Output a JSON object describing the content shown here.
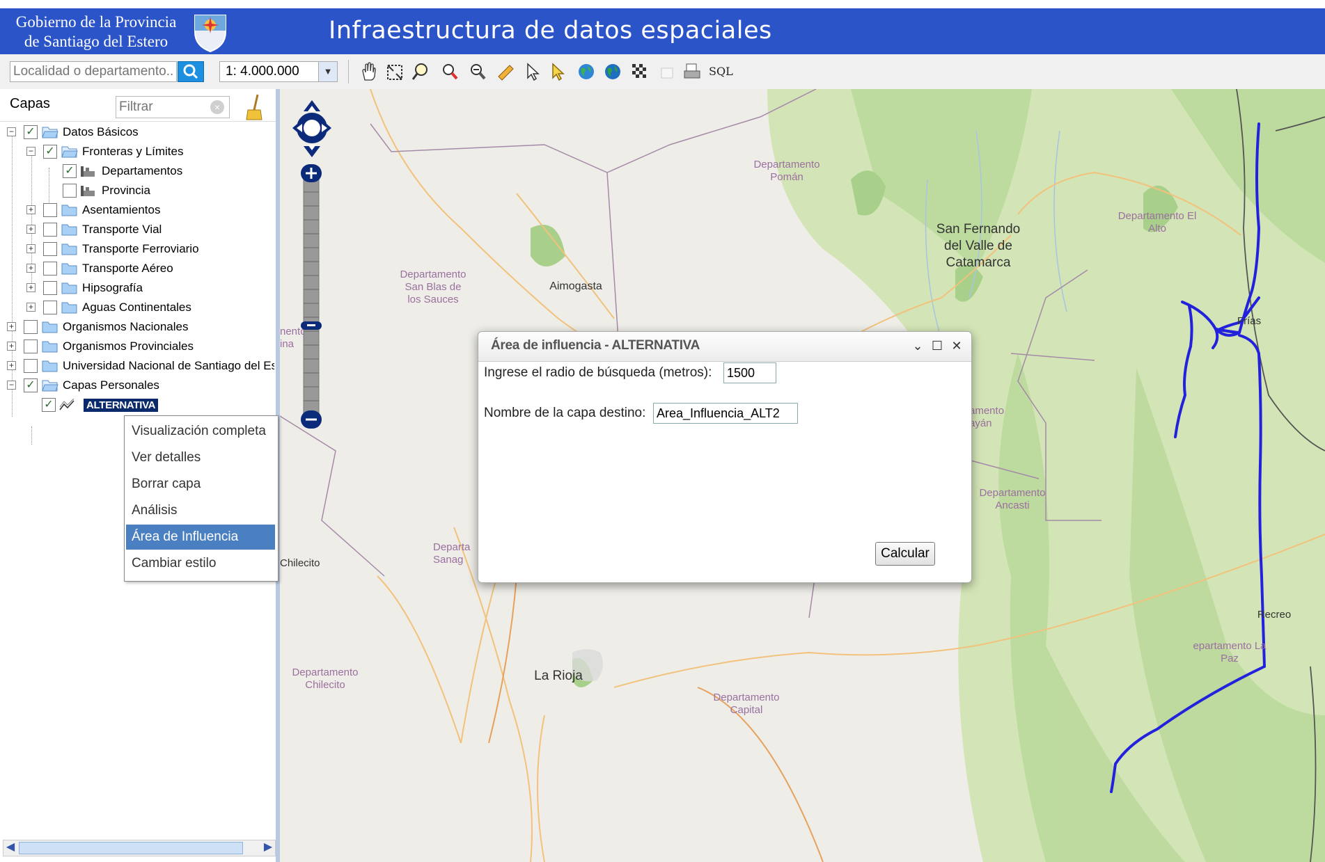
{
  "header": {
    "gov_line1": "Gobierno de la Provincia",
    "gov_line2": "de Santiago del Estero",
    "app_title": "Infraestructura de datos espaciales",
    "bg_color": "#2b54c9"
  },
  "toolbar": {
    "search_placeholder": "Localidad o departamento...",
    "scale_value": "1: 4.000.000",
    "sql_label": "SQL",
    "tools": [
      "pan-hand-icon",
      "zoom-extent-icon",
      "zoom-box-icon",
      "zoom-in-icon",
      "zoom-out-icon",
      "measure-icon",
      "info-icon",
      "select-icon",
      "globe-icon",
      "globe-2-icon",
      "grid-icon",
      "blank-icon",
      "print-icon"
    ]
  },
  "panel": {
    "title": "Capas",
    "filter_placeholder": "Filtrar",
    "tree": [
      {
        "label": "Datos Básicos",
        "checked": true
      },
      {
        "label": "Fronteras y Límites",
        "checked": true
      },
      {
        "label": "Departamentos",
        "checked": true
      },
      {
        "label": "Provincia",
        "checked": false
      },
      {
        "label": "Asentamientos",
        "checked": false
      },
      {
        "label": "Transporte Vial",
        "checked": false
      },
      {
        "label": "Transporte Ferroviario",
        "checked": false
      },
      {
        "label": "Transporte Aéreo",
        "checked": false
      },
      {
        "label": "Hipsografía",
        "checked": false
      },
      {
        "label": "Aguas Continentales",
        "checked": false
      },
      {
        "label": "Organismos Nacionales",
        "checked": false
      },
      {
        "label": "Organismos Provinciales",
        "checked": false
      },
      {
        "label": "Universidad Nacional de Santiago del Es",
        "checked": false
      },
      {
        "label": "Capas Personales",
        "checked": true
      },
      {
        "label": "ALTERNATIVA",
        "checked": true
      }
    ]
  },
  "context_menu": {
    "items": [
      "Visualización completa",
      "Ver detalles",
      "Borrar capa",
      "Análisis",
      "Área de Influencia",
      "Cambiar estilo"
    ],
    "active_item": "Área de Influencia"
  },
  "map": {
    "labels": {
      "dep_poman": "Departamento Pomán",
      "dep_el_alto": "Departamento El Alto",
      "san_fernando": "San Fernando del Valle de Catamarca",
      "dep_san_blas": "Departamento San Blas de los Sauces",
      "aimogasta": "Aimogasta",
      "frias": "Frías",
      "dep_ancasti": "Departamento Ancasti",
      "ambato_partial": "amento ayán",
      "recreo": "Recreo",
      "dep_la_paz": "epartamento La Paz",
      "la_rioja": "La Rioja",
      "dep_capital": "Departamento Capital",
      "dep_chilecito": "Departamento Chilecito",
      "chilecito": "Chilecito",
      "dep_sanag_partial": "Departa Sanag",
      "left_edge_partial": "nento ina"
    },
    "route_color": "#2222dd"
  },
  "dialog": {
    "title": "Área de influencia - ALTERNATIVA",
    "radius_label": "Ingrese el radio de búsqueda (metros):",
    "radius_value": "1500",
    "layer_label": "Nombre de la capa destino:",
    "layer_value": "Area_Influencia_ALT2",
    "calc_button": "Calcular",
    "collapse_glyph": "⌄",
    "maximize_glyph": "☐",
    "close_glyph": "✕"
  }
}
